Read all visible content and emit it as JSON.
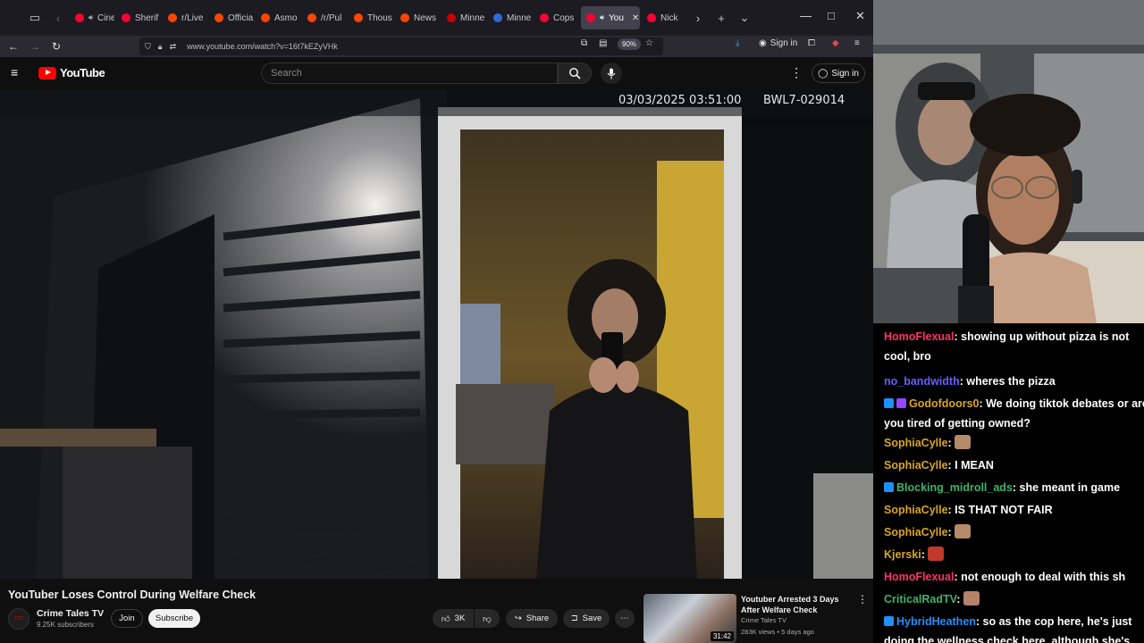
{
  "browser": {
    "tabs": [
      {
        "label": "Ciner",
        "color": "#ff0033",
        "audio": true
      },
      {
        "label": "Sherif",
        "color": "#ff0033"
      },
      {
        "label": "r/Live",
        "color": "#ff4500"
      },
      {
        "label": "Officia",
        "color": "#ff4500"
      },
      {
        "label": "Asmo",
        "color": "#ff4500"
      },
      {
        "label": "/r/Pul",
        "color": "#ff4500"
      },
      {
        "label": "Thous",
        "color": "#ff4500"
      },
      {
        "label": "News",
        "color": "#ff4500"
      },
      {
        "label": "Minne",
        "color": "#cc0000"
      },
      {
        "label": "Minne",
        "color": "#2f6ad8"
      },
      {
        "label": "Cops",
        "color": "#ff0033"
      },
      {
        "label": "You",
        "color": "#ff0033",
        "active": true,
        "audio": true
      },
      {
        "label": "Nick",
        "color": "#ff0033"
      }
    ],
    "url": "www.youtube.com/watch?v=16t7kEZyVHk",
    "zoom": "90%",
    "signin_label": "Sign in"
  },
  "youtube": {
    "logo_text": "YouTube",
    "search_placeholder": "Search",
    "signin_label": "Sign in"
  },
  "video": {
    "osd_datetime": "03/03/2025 03:51:00",
    "osd_device": "BWL7-029014"
  },
  "watch": {
    "title": "YouTuber Loses Control During Welfare Check",
    "channel_name": "Crime Tales TV",
    "channel_subs": "9.25K subscribers",
    "join_label": "Join",
    "subscribe_label": "Subscribe",
    "likes": "3K",
    "share_label": "Share",
    "save_label": "Save"
  },
  "recommended": {
    "title": "Youtuber Arrested 3 Days After Welfare Check",
    "channel": "Crime Tales TV",
    "meta": "283K views • 5 days ago",
    "duration": "31:42"
  },
  "chat": {
    "messages": [
      {
        "user": "HomoFlexual",
        "color": "#ff3366",
        "text": ": showing up without pizza is not cool, bro"
      },
      {
        "user": "no_bandwidth",
        "color": "#6a5cff",
        "text": ": wheres the pizza"
      },
      {
        "user": "Godofdoors0",
        "color": "#daa520",
        "text": ": We doing tiktok debates or are you tired of getting owned?",
        "badges": [
          "#1e90ff",
          "#9146ff"
        ]
      },
      {
        "user": "SophiaCylle",
        "color": "#daa520",
        "text": ":",
        "emote": "#b58a6a"
      },
      {
        "user": "SophiaCylle",
        "color": "#daa520",
        "text": ": I MEAN"
      },
      {
        "user": "Blocking_midroll_ads",
        "color": "#3cb371",
        "text": ": she meant in game",
        "badges": [
          "#1e90ff"
        ]
      },
      {
        "user": "SophiaCylle",
        "color": "#daa520",
        "text": ": IS THAT NOT FAIR"
      },
      {
        "user": "SophiaCylle",
        "color": "#daa520",
        "text": ":",
        "emote": "#b58a6a"
      },
      {
        "user": "Kjerski",
        "color": "#daa520",
        "text": ":",
        "emote": "#c0392b"
      },
      {
        "user": "HomoFlexual",
        "color": "#ff3366",
        "text": ": not enough to deal with this sh"
      },
      {
        "user": "CriticalRadTV",
        "color": "#3cb371",
        "text": ":",
        "emote": "#b5836a"
      },
      {
        "user": "HybridHeathen",
        "color": "#1e90ff",
        "text": ": so as the cop here, he's just doing the wellness check here, although she's",
        "badges": [
          "#1e90ff"
        ]
      }
    ]
  }
}
